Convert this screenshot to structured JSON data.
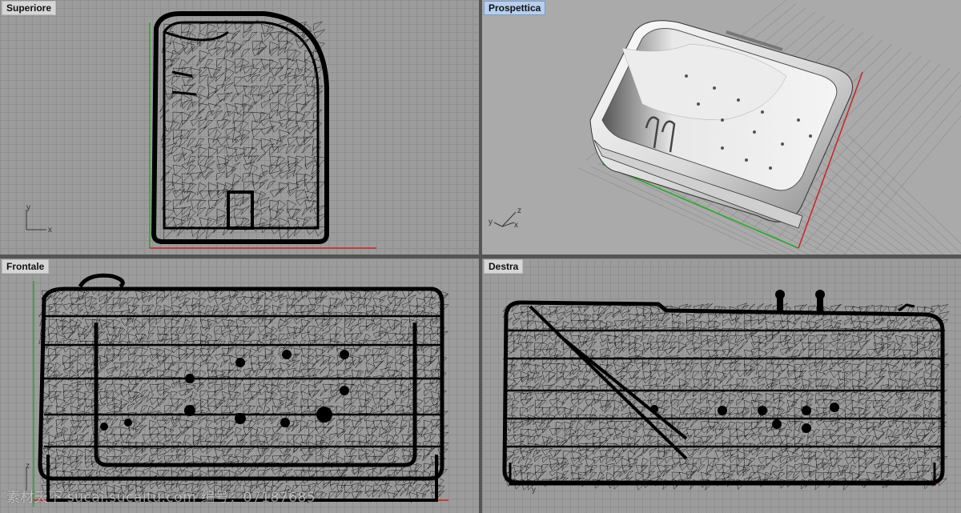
{
  "viewports": {
    "top": {
      "title": "Superiore",
      "active": false,
      "axes": {
        "a": "y",
        "b": "x"
      }
    },
    "persp": {
      "title": "Prospettica",
      "active": true,
      "axes": {
        "a": "y",
        "b": "x",
        "c": "z"
      }
    },
    "front": {
      "title": "Frontale",
      "active": false,
      "axes": {
        "a": "z"
      }
    },
    "right": {
      "title": "Destra",
      "active": false,
      "axes": {
        "a": "y"
      }
    }
  },
  "watermark": "素材天下 sucai.sucaitu.com  编号：07187685",
  "colors": {
    "grid_x_axis": "#cc2222",
    "grid_y_axis": "#22aa22",
    "wire": "#000000",
    "viewport_bg": "#9c9c9c"
  }
}
